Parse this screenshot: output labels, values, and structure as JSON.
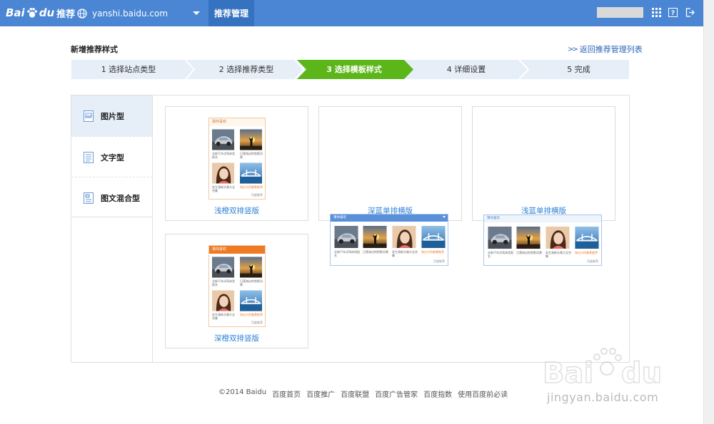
{
  "header": {
    "logo_bai": "Bai",
    "logo_du": "du",
    "logo_sub": "推荐",
    "site": "yanshi.baidu.com",
    "nav_active": "推荐管理",
    "bg_color": "#4a86d4",
    "active_color": "#3572bf"
  },
  "page": {
    "title": "新增推荐样式",
    "back_link": "返回推荐管理列表"
  },
  "steps": [
    {
      "label": "1 选择站点类型",
      "active": false
    },
    {
      "label": "2 选择推荐类型",
      "active": false
    },
    {
      "label": "3 选择模板样式",
      "active": true
    },
    {
      "label": "4 详细设置",
      "active": false
    },
    {
      "label": "5 完成",
      "active": false
    }
  ],
  "sidebar": {
    "items": [
      {
        "label": "图片型",
        "icon": "image-doc-icon",
        "active": true
      },
      {
        "label": "文字型",
        "icon": "text-doc-icon",
        "active": false
      },
      {
        "label": "图文混合型",
        "icon": "mixed-doc-icon",
        "active": false
      }
    ]
  },
  "templates": [
    {
      "label": "浅橙双排竖版"
    },
    {
      "label": "深蓝单排横版"
    },
    {
      "label": "浅蓝单排横版"
    },
    {
      "label": "深橙双排竖版"
    }
  ],
  "preview": {
    "header_text": "猜你喜欢",
    "captions": [
      "全新汽车试驾体验报名",
      "日落海边的剪影风景",
      "女生清新头像大全合集",
      "海边大桥美景推荐"
    ],
    "foot": "百度推荐"
  },
  "footer": {
    "copyright": "©2014 Baidu",
    "links": [
      "百度首页",
      "百度推广",
      "百度联盟",
      "百度广告管家",
      "百度指数",
      "使用百度前必读"
    ]
  },
  "watermark": {
    "text": "jingyan.baidu.com"
  }
}
